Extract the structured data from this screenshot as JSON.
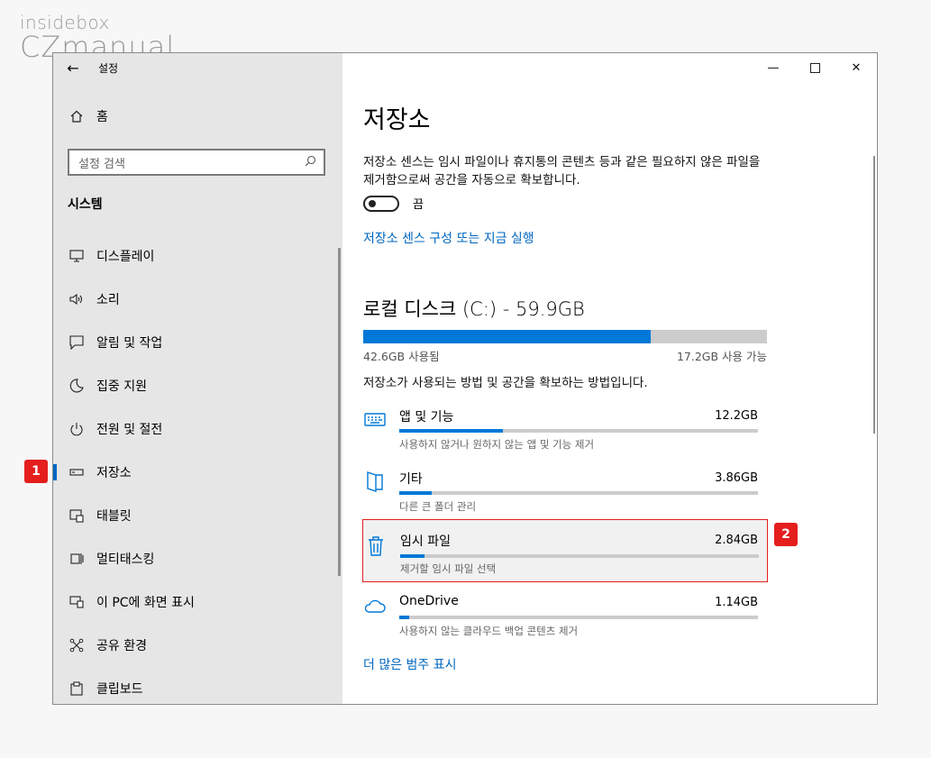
{
  "watermark": {
    "line1": "insidebox",
    "line2": "CZmanual"
  },
  "window": {
    "title": "설정",
    "back_icon": "arrow-left-icon",
    "controls": [
      "minimize",
      "maximize",
      "close"
    ]
  },
  "sidebar": {
    "home_label": "홈",
    "search_placeholder": "설정 검색",
    "section_title": "시스템",
    "items": [
      {
        "label": "디스플레이",
        "icon": "monitor-icon"
      },
      {
        "label": "소리",
        "icon": "speaker-icon"
      },
      {
        "label": "알림 및 작업",
        "icon": "notification-icon"
      },
      {
        "label": "집중 지원",
        "icon": "moon-icon"
      },
      {
        "label": "전원 및 절전",
        "icon": "power-icon"
      },
      {
        "label": "저장소",
        "icon": "drive-icon",
        "active": true
      },
      {
        "label": "태블릿",
        "icon": "tablet-icon"
      },
      {
        "label": "멀티태스킹",
        "icon": "multitask-icon"
      },
      {
        "label": "이 PC에 화면 표시",
        "icon": "project-icon"
      },
      {
        "label": "공유 환경",
        "icon": "share-icon"
      },
      {
        "label": "클립보드",
        "icon": "clipboard-icon"
      }
    ]
  },
  "badges": {
    "b1": "1",
    "b2": "2",
    "color": "#e51e1e"
  },
  "main": {
    "title": "저장소",
    "description": "저장소 센스는 임시 파일이나 휴지통의 콘텐츠 등과 같은 필요하지 않은 파일을 제거함으로써 공간을 자동으로 확보합니다.",
    "toggle_label": "끔",
    "toggle_state": false,
    "configure_link": "저장소 센스 구성 또는 지금 실행",
    "disk": {
      "title": "로컬 디스크 (C:) - 59.9GB",
      "used": "42.6GB 사용됨",
      "free": "17.2GB 사용 가능",
      "used_fraction": 0.711
    },
    "subhead": "저장소가 사용되는 방법 및 공간을 확보하는 방법입니다.",
    "categories": [
      {
        "name": "앱 및 기능",
        "size": "12.2GB",
        "desc": "사용하지 않거나 원하지 않는 앱 및 기능 제거",
        "fraction": 0.29,
        "icon": "keyboard-icon"
      },
      {
        "name": "기타",
        "size": "3.86GB",
        "desc": "다른 큰 폴더 관리",
        "fraction": 0.09,
        "icon": "folder-icon"
      },
      {
        "name": "임시 파일",
        "size": "2.84GB",
        "desc": "제거할 임시 파일 선택",
        "fraction": 0.068,
        "icon": "trash-icon",
        "highlight": true
      },
      {
        "name": "OneDrive",
        "size": "1.14GB",
        "desc": "사용하지 않는 클라우드 백업 콘텐츠 제거",
        "fraction": 0.028,
        "icon": "cloud-icon"
      }
    ],
    "more_link": "더 많은 범주 표시"
  },
  "colors": {
    "accent": "#0078d7",
    "link": "#0067c0",
    "sidebar_bg": "#e6e6e6",
    "highlight_border": "#e51e1e"
  }
}
